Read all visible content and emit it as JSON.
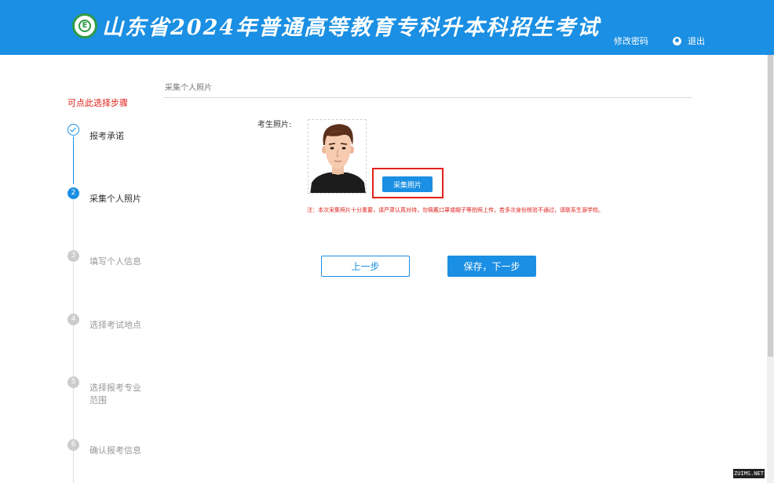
{
  "header": {
    "title": "山东省2024年普通高等教育专科升本科招生考试",
    "logo_icon": "school-emblem-icon",
    "logo_letter": "E",
    "change_password": "修改密码",
    "logout": "退出",
    "bg_color": "#1a8fe3"
  },
  "steps": {
    "hint": "可点此选择步骤",
    "items": [
      {
        "marker": "",
        "label": "报考承诺",
        "state": "done"
      },
      {
        "marker": "2",
        "label": "采集个人照片",
        "state": "active"
      },
      {
        "marker": "3",
        "label": "填写个人信息",
        "state": "pending"
      },
      {
        "marker": "4",
        "label": "选择考试地点",
        "state": "pending"
      },
      {
        "marker": "5",
        "label": "选择报考专业范围",
        "state": "pending"
      },
      {
        "marker": "6",
        "label": "确认报考信息",
        "state": "pending"
      }
    ]
  },
  "main": {
    "section_title": "采集个人照片",
    "photo_label": "考生照片:",
    "capture_button": "采集照片",
    "notice": "注：本次采集照片十分重要，请严肃认真对待，勿佩戴口罩或帽子等拍照上传，若多次身份核验不通过，请联系生源学校。",
    "prev_button": "上一步",
    "next_button": "保存，下一步"
  },
  "watermark": "ZUIMS.NET",
  "colors": {
    "accent": "#1a8fe3",
    "warning": "#e0201b"
  }
}
